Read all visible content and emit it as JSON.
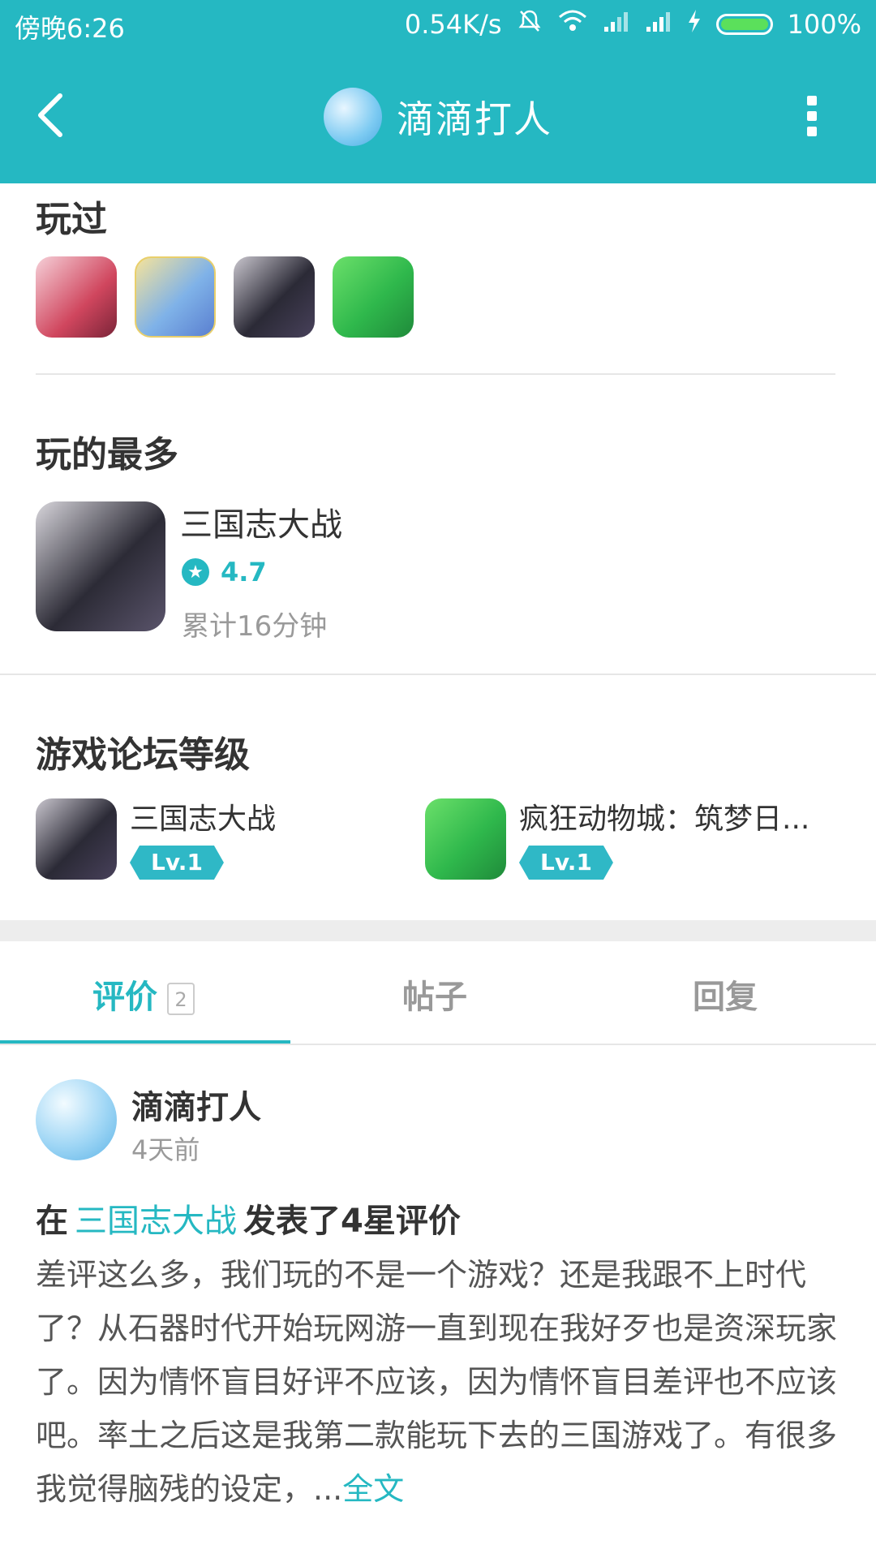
{
  "status_bar": {
    "time": "傍晚6:26",
    "speed": "0.54K/s",
    "battery": "100%"
  },
  "header": {
    "title": "滴滴打人"
  },
  "played": {
    "title": "玩过"
  },
  "most_played": {
    "title": "玩的最多",
    "game_name": "三国志大战",
    "rating": "4.7",
    "playtime": "累计16分钟"
  },
  "forum": {
    "title": "游戏论坛等级",
    "items": [
      {
        "name": "三国志大战",
        "level": "Lv.1"
      },
      {
        "name": "疯狂动物城：筑梦日...",
        "level": "Lv.1"
      }
    ]
  },
  "tabs": [
    {
      "label": "评价",
      "count": "2"
    },
    {
      "label": "帖子"
    },
    {
      "label": "回复"
    }
  ],
  "review": {
    "author": "滴滴打人",
    "time": "4天前",
    "prefix": "在",
    "game_link": "三国志大战",
    "suffix": "发表了4星评价",
    "body": "差评这么多，我们玩的不是一个游戏？还是我跟不上时代了？从石器时代开始玩网游一直到现在我好歹也是资深玩家了。因为情怀盲目好评不应该，因为情怀盲目差评也不应该吧。率土之后这是我第二款能玩下去的三国游戏了。有很多我觉得脑残的设定，...",
    "more": "全文"
  },
  "colors": {
    "accent": "#25b8c2",
    "text": "#333333",
    "muted": "#9a9a9a"
  }
}
